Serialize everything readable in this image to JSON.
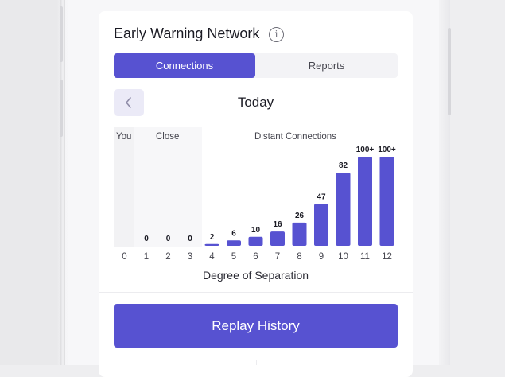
{
  "card": {
    "title": "Early Warning Network",
    "info_icon": "info-icon",
    "info_glyph": "i"
  },
  "tabs": [
    {
      "label": "Connections",
      "active": true
    },
    {
      "label": "Reports",
      "active": false
    }
  ],
  "date_nav": {
    "prev_icon": "chevron-left-icon",
    "current": "Today"
  },
  "chart_data": {
    "type": "bar",
    "title": "",
    "xlabel": "Degree of Separation",
    "ylabel": "",
    "regions": [
      {
        "label": "You",
        "degrees": [
          0
        ]
      },
      {
        "label": "Close",
        "degrees": [
          1,
          2,
          3
        ]
      },
      {
        "label": "Distant Connections",
        "degrees": [
          4,
          5,
          6,
          7,
          8,
          9,
          10,
          11,
          12
        ]
      }
    ],
    "categories": [
      "0",
      "1",
      "2",
      "3",
      "4",
      "5",
      "6",
      "7",
      "8",
      "9",
      "10",
      "11",
      "12"
    ],
    "values": [
      null,
      0,
      0,
      0,
      2,
      6,
      10,
      16,
      26,
      47,
      82,
      100,
      100
    ],
    "labels": [
      "",
      "0",
      "0",
      "0",
      "2",
      "6",
      "10",
      "16",
      "26",
      "47",
      "82",
      "100+",
      "100+"
    ],
    "ylim": [
      0,
      100
    ],
    "bar_color": "#5752d1"
  },
  "actions": {
    "replay_label": "Replay History"
  },
  "colors": {
    "accent": "#5752d1",
    "accent_light": "#ebeaf7",
    "text": "#1b1b24"
  }
}
